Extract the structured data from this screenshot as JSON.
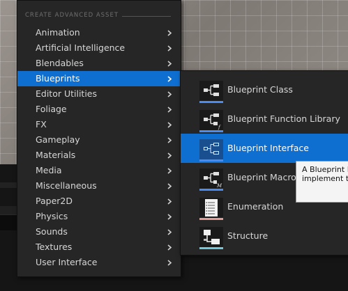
{
  "menu": {
    "section_header": "CREATE ADVANCED ASSET",
    "items": [
      {
        "label": "Animation"
      },
      {
        "label": "Artificial Intelligence"
      },
      {
        "label": "Blendables"
      },
      {
        "label": "Blueprints",
        "active": true
      },
      {
        "label": "Editor Utilities"
      },
      {
        "label": "Foliage"
      },
      {
        "label": "FX"
      },
      {
        "label": "Gameplay"
      },
      {
        "label": "Materials"
      },
      {
        "label": "Media"
      },
      {
        "label": "Miscellaneous"
      },
      {
        "label": "Paper2D"
      },
      {
        "label": "Physics"
      },
      {
        "label": "Sounds"
      },
      {
        "label": "Textures"
      },
      {
        "label": "User Interface"
      }
    ]
  },
  "submenu": {
    "items": [
      {
        "label": "Blueprint Class",
        "icon": "blueprint-class-icon",
        "bar_color": "#4a8df0"
      },
      {
        "label": "Blueprint Function Library",
        "icon": "blueprint-function-library-icon",
        "bar_color": "#4a8df0"
      },
      {
        "label": "Blueprint Interface",
        "icon": "blueprint-interface-icon",
        "bar_color": "#4a8df0",
        "active": true
      },
      {
        "label": "Blueprint Macro Library",
        "icon": "blueprint-macro-library-icon",
        "bar_color": "#4a8df0"
      },
      {
        "label": "Enumeration",
        "icon": "enumeration-icon",
        "bar_color": "#e39b96"
      },
      {
        "label": "Structure",
        "icon": "structure-icon",
        "bar_color": "#6fc9d9"
      }
    ]
  },
  "tooltip": {
    "line1": "A Blueprint I",
    "line2": "implement th"
  },
  "colors": {
    "menu_bg": "#262626",
    "active_bg": "#0e6fd1",
    "text": "#d7d7d7",
    "header_text": "#6f6f6f"
  }
}
